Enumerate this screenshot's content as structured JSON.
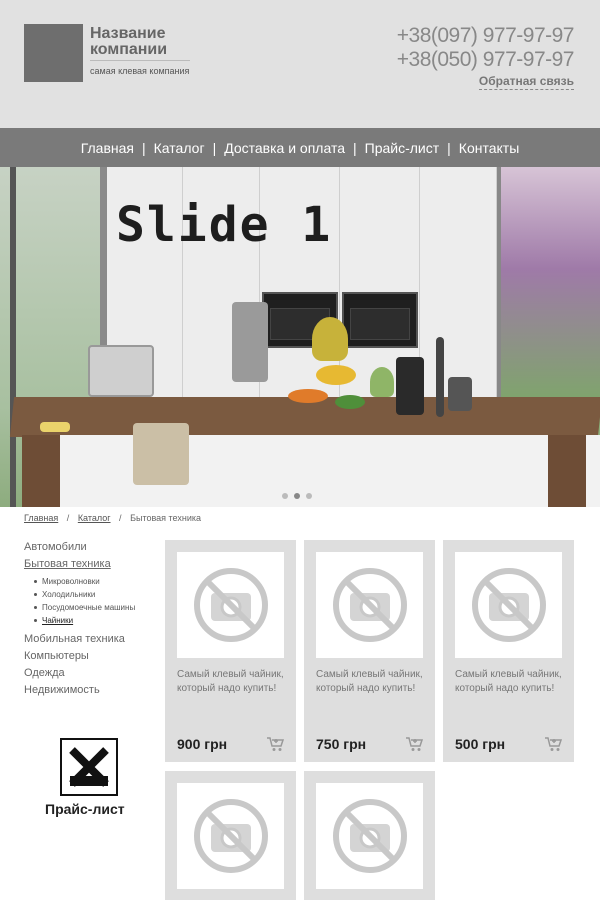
{
  "header": {
    "company_name_line1": "Название",
    "company_name_line2": "компании",
    "slogan": "самая клевая компания",
    "phone1": "+38(097) 977-97-97",
    "phone2": "+38(050) 977-97-97",
    "feedback": "Обратная связь"
  },
  "nav": {
    "items": [
      "Главная",
      "Каталог",
      "Доставка и оплата",
      "Прайс-лист",
      "Контакты"
    ],
    "separator": "|"
  },
  "slider": {
    "title": "Slide 1",
    "slide_count": 3,
    "active_slide": 2
  },
  "breadcrumb": {
    "items": [
      "Главная",
      "Каталог",
      "Бытовая техника"
    ],
    "separator": "/"
  },
  "sidebar": {
    "categories": [
      "Автомобили",
      "Бытовая техника",
      "Мобильная техника",
      "Компьютеры",
      "Одежда",
      "Недвижимость"
    ],
    "subcategories": [
      "Микроволновки",
      "Холодильники",
      "Посудомоечные машины",
      "Чайники"
    ],
    "price_list_label": "Прайс-лист"
  },
  "products": [
    {
      "title": "Самый клевый чайник, который надо купить!",
      "price": "900 грн"
    },
    {
      "title": "Самый клевый чайник, который надо купить!",
      "price": "750 грн"
    },
    {
      "title": "Самый клевый чайник, который надо купить!",
      "price": "500 грн"
    }
  ],
  "colors": {
    "header_bg": "#e1e1e1",
    "nav_bg": "#7a7a7a",
    "card_bg": "#dedede",
    "logo_box": "#6e6e6e"
  }
}
